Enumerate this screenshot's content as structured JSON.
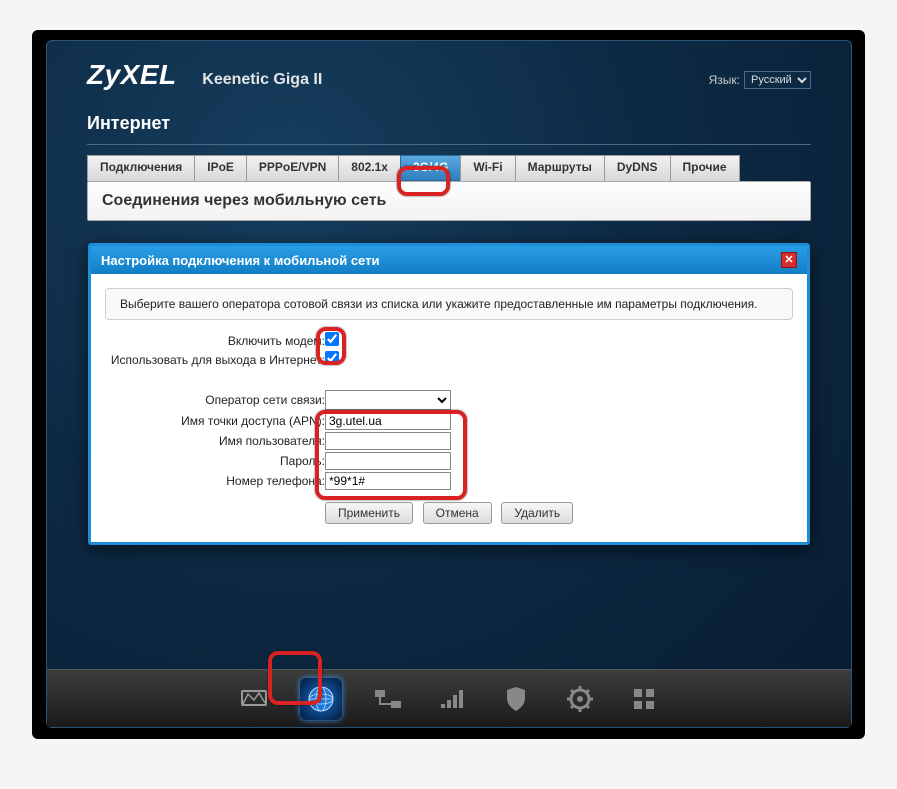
{
  "header": {
    "logo": "ZyXEL",
    "product": "Keenetic Giga II",
    "lang_label": "Язык:",
    "lang_value": "Русский"
  },
  "page_title": "Интернет",
  "tabs": [
    {
      "label": "Подключения"
    },
    {
      "label": "IPoE"
    },
    {
      "label": "PPPoE/VPN"
    },
    {
      "label": "802.1x"
    },
    {
      "label": "3G/4G",
      "active": true
    },
    {
      "label": "Wi-Fi"
    },
    {
      "label": "Маршруты"
    },
    {
      "label": "DyDNS"
    },
    {
      "label": "Прочие"
    }
  ],
  "section": {
    "title": "Соединения через мобильную сеть"
  },
  "dialog": {
    "title": "Настройка подключения к мобильной сети",
    "hint": "Выберите вашего оператора сотовой связи из списка или укажите предоставленные им параметры подключения.",
    "fields": {
      "enable_modem_label": "Включить модем:",
      "enable_modem_checked": true,
      "use_internet_label": "Использовать для выхода в Интернет:",
      "use_internet_checked": true,
      "operator_label": "Оператор сети связи:",
      "operator_value": "",
      "apn_label": "Имя точки доступа (APN):",
      "apn_value": "3g.utel.ua",
      "username_label": "Имя пользователя:",
      "username_value": "",
      "password_label": "Пароль:",
      "password_value": "",
      "phone_label": "Номер телефона:",
      "phone_value": "*99*1#"
    },
    "buttons": {
      "apply": "Применить",
      "cancel": "Отмена",
      "delete": "Удалить"
    }
  },
  "nav_icons": [
    "monitor-icon",
    "globe-icon",
    "net-icon",
    "signal-icon",
    "shield-icon",
    "gear-icon",
    "apps-icon"
  ]
}
